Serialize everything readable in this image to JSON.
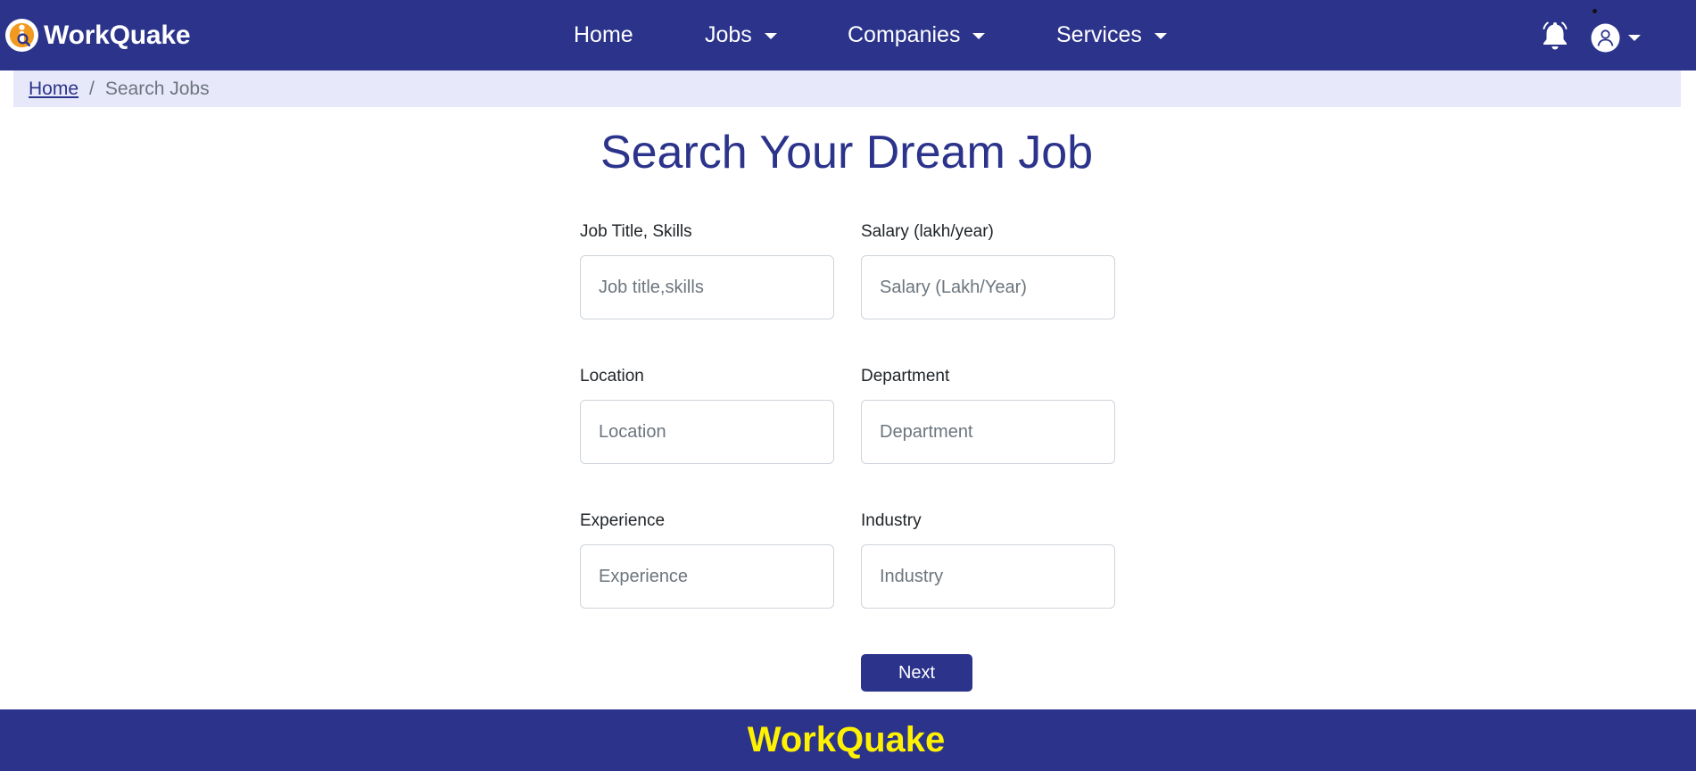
{
  "brand": {
    "name": "WorkQuake",
    "logo_icon": "workquake-logo-icon"
  },
  "nav": {
    "items": [
      {
        "label": "Home",
        "has_dropdown": false
      },
      {
        "label": "Jobs",
        "has_dropdown": true
      },
      {
        "label": "Companies",
        "has_dropdown": true
      },
      {
        "label": "Services",
        "has_dropdown": true
      }
    ],
    "notification_icon": "bell-icon",
    "profile_icon": "user-avatar-icon"
  },
  "breadcrumb": {
    "home": "Home",
    "separator": "/",
    "current": "Search Jobs"
  },
  "page": {
    "title": "Search Your Dream Job"
  },
  "form": {
    "fields": [
      {
        "label": "Job Title, Skills",
        "placeholder": "Job title,skills",
        "value": ""
      },
      {
        "label": "Salary (lakh/year)",
        "placeholder": "Salary (Lakh/Year)",
        "value": ""
      },
      {
        "label": "Location",
        "placeholder": "Location",
        "value": ""
      },
      {
        "label": "Department",
        "placeholder": "Department",
        "value": ""
      },
      {
        "label": "Experience",
        "placeholder": "Experience",
        "value": ""
      },
      {
        "label": "Industry",
        "placeholder": "Industry",
        "value": ""
      }
    ],
    "next_label": "Next"
  },
  "footer": {
    "brand": "WorkQuake"
  },
  "colors": {
    "primary": "#2b338b",
    "breadcrumb_bg": "#e8e8fb",
    "footer_brand": "#fff200",
    "logo_orange": "#f29a1f"
  }
}
